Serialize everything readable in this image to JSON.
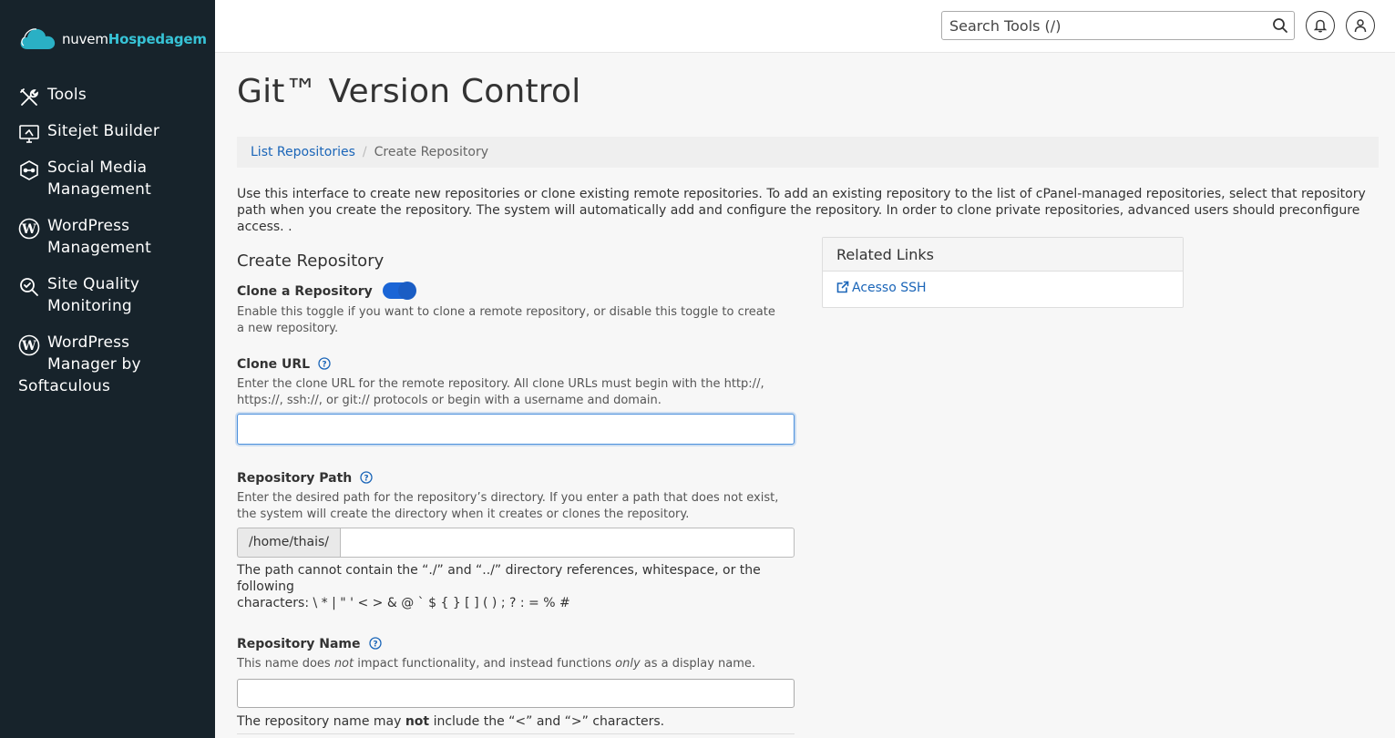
{
  "brand": {
    "name_light": "nuvem",
    "name_bold": "Hospedagem",
    "accent": "#37c3d6"
  },
  "sidebar": {
    "items": [
      {
        "label": "Tools",
        "icon": "tools-icon"
      },
      {
        "label": "Sitejet Builder",
        "icon": "sitejet-icon"
      },
      {
        "label_line1": "Social Media",
        "label_line2": "Management",
        "icon": "social-media-icon"
      },
      {
        "label_line1": "WordPress",
        "label_line2": "Management",
        "icon": "wordpress-icon"
      },
      {
        "label_line1": "Site Quality",
        "label_line2": "Monitoring",
        "icon": "site-quality-icon"
      },
      {
        "label_line1": "WordPress",
        "label_line2": "Manager by",
        "label_line3": "Softaculous",
        "icon": "wordpress-icon"
      }
    ]
  },
  "topbar": {
    "search_placeholder": "Search Tools (/)",
    "notifications_icon": "bell-icon",
    "user_icon": "user-icon"
  },
  "page": {
    "title": "Git™ Version Control",
    "breadcrumb": {
      "parent": "List Repositories",
      "separator": "/",
      "current": "Create Repository"
    },
    "intro": "Use this interface to create new repositories or clone existing remote repositories. To add an existing repository to the list of cPanel-managed repositories, select that repository path when you create the repository. The system will automatically add and configure the repository. In order to clone private repositories, advanced users should preconfigure access. ."
  },
  "form": {
    "section_title": "Create Repository",
    "clone_toggle": {
      "label": "Clone a Repository",
      "enabled": true,
      "help": "Enable this toggle if you want to clone a remote repository, or disable this toggle to create a new repository."
    },
    "clone_url": {
      "label": "Clone URL",
      "help": "Enter the clone URL for the remote repository. All clone URLs must begin with the http://, https://, ssh://, or git:// protocols or begin with a username and domain.",
      "value": ""
    },
    "repo_path": {
      "label": "Repository Path",
      "help": "Enter the desired path for the repository’s directory. If you enter a path that does not exist, the system will create the directory when it creates or clones the repository.",
      "prefix": "/home/thais/",
      "value": "",
      "note_line1": "The path cannot contain the “./” and “../” directory references, whitespace, or the following",
      "note_line2": "characters: \\ * | \" ' < > & @ ` $ { } [ ] ( ) ; ? : = % #"
    },
    "repo_name": {
      "label": "Repository Name",
      "help_a": "This name does ",
      "help_not": "not",
      "help_b": " impact functionality, and instead functions ",
      "help_only": "only",
      "help_c": " as a display name.",
      "value": "",
      "note_a": "The repository name may ",
      "note_not": "not",
      "note_b": " include the “<” and “>” characters."
    }
  },
  "related_links": {
    "title": "Related Links",
    "items": [
      {
        "label": "Acesso SSH",
        "icon": "external-link-icon"
      }
    ]
  }
}
